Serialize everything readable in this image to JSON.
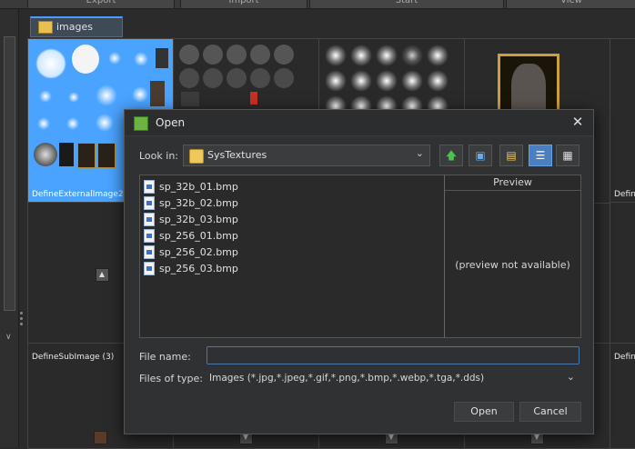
{
  "toolbar": {
    "items": [
      "Export",
      "Import",
      "Start",
      "View"
    ]
  },
  "tabs": [
    {
      "label": "images"
    }
  ],
  "grid": {
    "cell_captions": [
      "DefineExternalImage2 (",
      "DefineSubImage (3)",
      "Defin",
      "Defin"
    ]
  },
  "dialog": {
    "title": "Open",
    "look_in_label": "Look in:",
    "look_in_value": "SysTextures",
    "files": [
      "sp_32b_01.bmp",
      "sp_32b_02.bmp",
      "sp_32b_03.bmp",
      "sp_256_01.bmp",
      "sp_256_02.bmp",
      "sp_256_03.bmp"
    ],
    "preview_header": "Preview",
    "preview_text": "(preview not available)",
    "file_name_label": "File name:",
    "file_name_value": "",
    "files_of_type_label": "Files of type:",
    "files_of_type_value": "Images (*.jpg,*.jpeg,*.gif,*.png,*.bmp,*.webp,*.tga,*.dds)",
    "open_button": "Open",
    "cancel_button": "Cancel"
  },
  "colors": {
    "accent": "#4a9cff",
    "selected_cell": "#4aa3ff",
    "background": "#2b2b2b"
  },
  "icons": [
    "close-icon",
    "up-folder-icon",
    "desktop-icon",
    "new-folder-icon",
    "list-view-icon",
    "details-view-icon",
    "folder-icon",
    "file-icon",
    "chevron-down-icon"
  ]
}
